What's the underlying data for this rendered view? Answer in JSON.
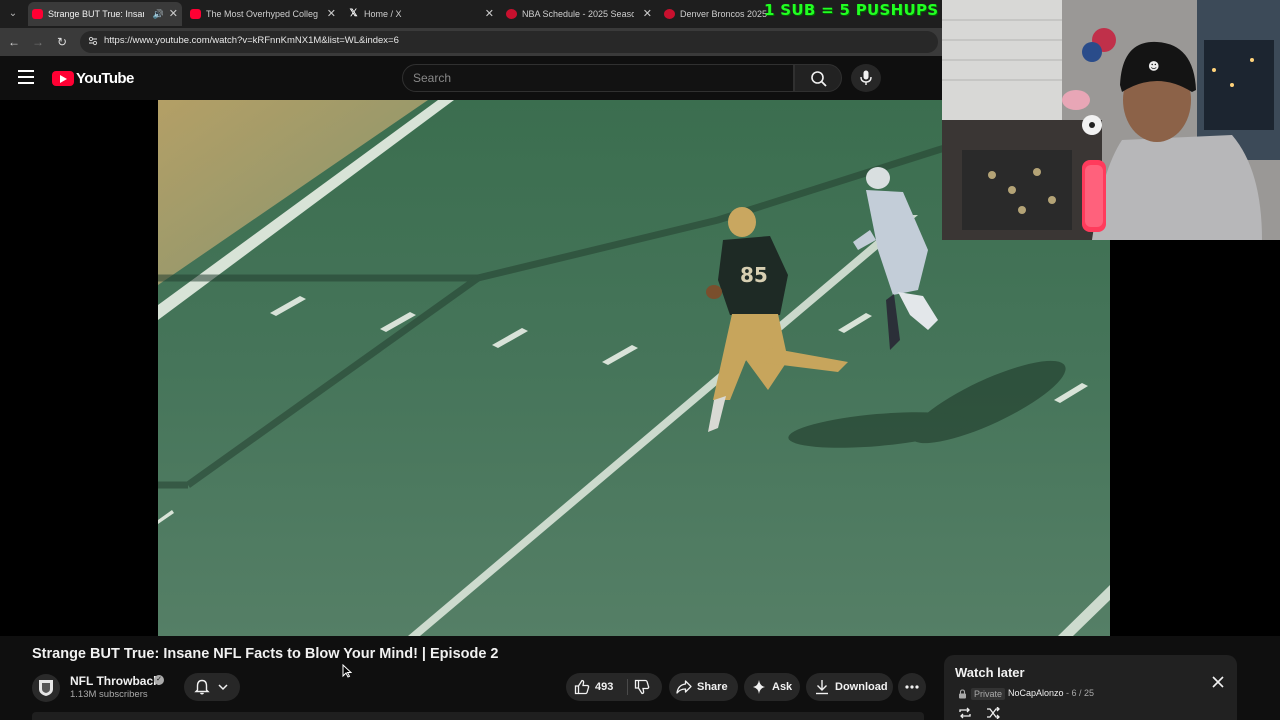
{
  "browser": {
    "tabs": [
      {
        "title": "Strange BUT True: Insane NFL",
        "favicon": "youtube-favicon",
        "active": true
      },
      {
        "title": "The Most Overhyped College F",
        "favicon": "youtube-favicon",
        "active": false
      },
      {
        "title": "Home / X",
        "favicon": "x-favicon",
        "active": false
      },
      {
        "title": "NBA Schedule - 2025 Season -",
        "favicon": "nba-favicon",
        "active": false
      },
      {
        "title": "Denver Broncos 2025 NFL D",
        "favicon": "nba-favicon",
        "active": false
      }
    ],
    "url": "https://www.youtube.com/watch?v=kRFnnKmNX1M&list=WL&index=6"
  },
  "stream_overlay": {
    "sub_goal_text": "1 SUB = 5 PUSHUPS"
  },
  "youtube": {
    "logo_text": "YouTube",
    "search": {
      "placeholder": "Search",
      "value": ""
    }
  },
  "video": {
    "title": "Strange BUT True: Insane NFL Facts to Blow Your Mind! | Episode 2",
    "channel": {
      "name": "NFL Throwback",
      "subscribers": "1.13M subscribers"
    },
    "actions": {
      "like_count": "493",
      "share_label": "Share",
      "ask_label": "Ask",
      "download_label": "Download"
    }
  },
  "watch_later": {
    "title": "Watch later",
    "privacy": "Private",
    "owner": "NoCapAlonzo",
    "position": "- 6 / 25"
  },
  "colors": {
    "background": "#0f0f0f",
    "youtube_red": "#ff0033",
    "overlay_green": "#22ff22",
    "panel": "#212121",
    "pill": "#272727"
  }
}
